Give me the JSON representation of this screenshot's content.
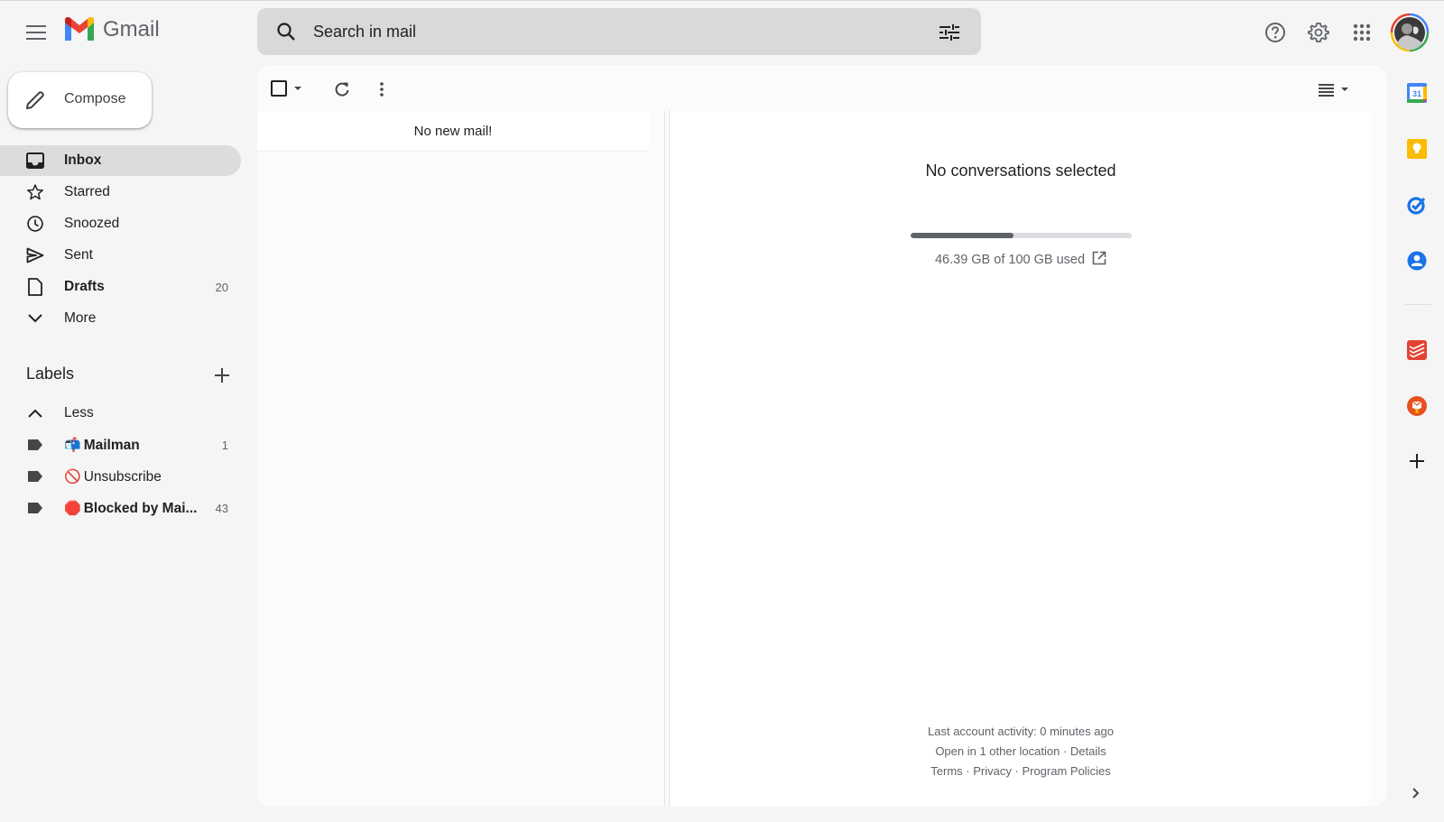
{
  "app": {
    "name": "Gmail",
    "colors": {
      "background": "#f5f5f5",
      "search_bg": "#d9d9d9",
      "active_nav_bg": "#dcdcdc",
      "storage_fill": "#5f6368",
      "storage_track": "#dadce0"
    }
  },
  "header": {
    "menu_icon": "hamburger-menu-icon",
    "logo_text": "Gmail",
    "search": {
      "placeholder": "Search in mail",
      "value": "",
      "search_icon": "search-icon",
      "filter_icon": "search-options-sliders-icon"
    },
    "actions": [
      {
        "name": "support",
        "icon": "help-circle-icon"
      },
      {
        "name": "settings",
        "icon": "gear-icon"
      },
      {
        "name": "google-apps",
        "icon": "apps-grid-icon"
      },
      {
        "name": "account",
        "icon": "avatar-photo"
      }
    ]
  },
  "sidebar": {
    "compose_label": "Compose",
    "items": [
      {
        "label": "Inbox",
        "icon": "inbox-icon",
        "count": "",
        "bold": true,
        "active": true
      },
      {
        "label": "Starred",
        "icon": "star-icon",
        "count": "",
        "bold": false,
        "active": false
      },
      {
        "label": "Snoozed",
        "icon": "clock-icon",
        "count": "",
        "bold": false,
        "active": false
      },
      {
        "label": "Sent",
        "icon": "send-icon",
        "count": "",
        "bold": false,
        "active": false
      },
      {
        "label": "Drafts",
        "icon": "draft-icon",
        "count": "20",
        "bold": true,
        "active": false
      },
      {
        "label": "More",
        "icon": "chevron-down-icon",
        "count": "",
        "bold": false,
        "active": false
      }
    ],
    "labels_heading": "Labels",
    "labels_toggle": "Less",
    "labels": [
      {
        "emoji": "📬",
        "label": "Mailman",
        "count": "1",
        "bold": true
      },
      {
        "emoji": "🚫",
        "label": "Unsubscribe",
        "count": "",
        "bold": false
      },
      {
        "emoji": "🛑",
        "label": "Blocked by Mai...",
        "count": "43",
        "bold": true
      }
    ]
  },
  "toolbar": {
    "select_icon": "checkbox-icon",
    "refresh_icon": "refresh-icon",
    "more_icon": "more-vertical-icon",
    "density_icon": "split-pane-toggle-icon"
  },
  "list": {
    "empty_message": "No new mail!"
  },
  "reading_pane": {
    "empty_message": "No conversations selected",
    "storage": {
      "used_gb": 46.39,
      "total_gb": 100,
      "fraction_used": 0.4639,
      "text": "46.39 GB of 100 GB used"
    },
    "footer": {
      "activity": "Last account activity: 0 minutes ago",
      "locations_prefix": "Open in 1 other location",
      "separator": " · ",
      "details_link": "Details",
      "links": [
        "Terms",
        "Privacy",
        "Program Policies"
      ]
    }
  },
  "side_panel": {
    "apps": [
      {
        "name": "Calendar",
        "icon": "google-calendar-icon",
        "badge": "31"
      },
      {
        "name": "Keep",
        "icon": "google-keep-icon"
      },
      {
        "name": "Tasks",
        "icon": "google-tasks-icon"
      },
      {
        "name": "Contacts",
        "icon": "google-contacts-icon"
      },
      {
        "name": "Todoist",
        "icon": "todoist-icon"
      },
      {
        "name": "Mailman",
        "icon": "mailman-addon-icon"
      },
      {
        "name": "Get add-ons",
        "icon": "plus-icon"
      }
    ],
    "toggle_icon": "chevron-right-icon"
  }
}
